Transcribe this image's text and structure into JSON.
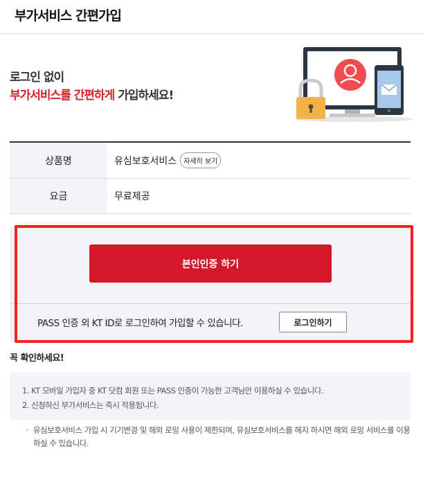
{
  "header": {
    "title": "부가서비스 간편가입"
  },
  "hero": {
    "line1": "로그인 없이",
    "line2_highlight": "부가서비스를 간편하게",
    "line2_rest": " 가입하세요!"
  },
  "info": {
    "rows": [
      {
        "label": "상품명",
        "value": "유심보호서비스",
        "button": "자세히 보기"
      },
      {
        "label": "요금",
        "value": "무료제공"
      }
    ]
  },
  "auth": {
    "primary_button": "본인인증 하기",
    "alt_text": "PASS 인증 외 KT ID로 로그인하여 가입할 수 있습니다.",
    "login_button": "로그인하기"
  },
  "notice": {
    "title": "꼭 확인하세요!",
    "items": [
      "1. KT 모바일 가입자 중 KT 닷컴 회원 또는 PASS 인증이 가능한 고객님만 이용하실 수 있습니다.",
      "2. 신청하신 부가서비스는 즉시 적용됩니다."
    ],
    "sub_note_bullet": "·",
    "sub_note": "유심보호서비스 가입 시 기기변경 및 해외 로밍 사용이 제한되며, 유심보호서비스를 해지 하시면 해외 로밍 서비스를 이용 하실 수 있습니다."
  },
  "colors": {
    "accent_red": "#d3182a",
    "highlight_border": "#f2231e",
    "panel_bg": "#f2f2f8"
  },
  "icons": [
    "padlock-icon",
    "monitor-icon",
    "user-avatar-icon",
    "smartphone-icon",
    "mail-icon"
  ]
}
